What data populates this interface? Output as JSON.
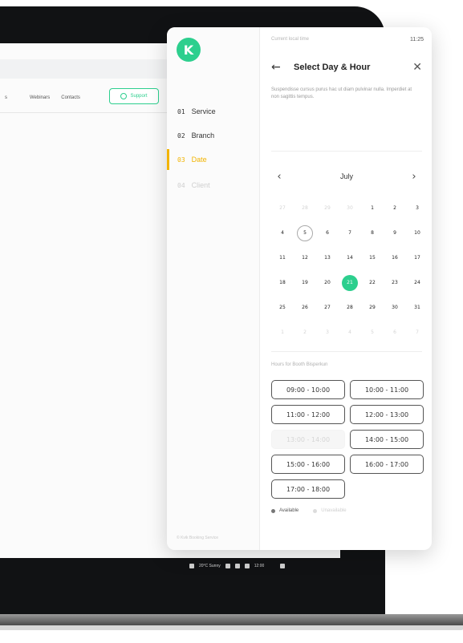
{
  "website": {
    "nav_items": [
      "s",
      "Webinars",
      "Contacts"
    ],
    "support_label": "Support"
  },
  "taskbar": {
    "weather": "20°C Sunny",
    "clock": "12:00"
  },
  "panel": {
    "steps": [
      {
        "num": "01",
        "label": "Service",
        "state": "done"
      },
      {
        "num": "02",
        "label": "Branch",
        "state": "done"
      },
      {
        "num": "03",
        "label": "Date",
        "state": "active"
      },
      {
        "num": "04",
        "label": "Client",
        "state": "disabled"
      }
    ],
    "footer_note": "© Kvik Booking Service"
  },
  "status_bar": {
    "left": "Current local time",
    "time": "11:25"
  },
  "header": {
    "back_icon": "←",
    "title": "Select Day & Hour",
    "close_icon": "✕"
  },
  "description": "Suspendisse cursus purus hac ut diam pulvinar nulla. Imperdiet at non sagittis tempus.",
  "calendar": {
    "prev_icon": "‹",
    "next_icon": "›",
    "month": "July",
    "weeks": [
      [
        {
          "d": "27",
          "s": "muted"
        },
        {
          "d": "28",
          "s": "muted"
        },
        {
          "d": "29",
          "s": "muted"
        },
        {
          "d": "30",
          "s": "muted"
        },
        {
          "d": "1",
          "s": ""
        },
        {
          "d": "2",
          "s": ""
        },
        {
          "d": "3",
          "s": ""
        }
      ],
      [
        {
          "d": "4",
          "s": ""
        },
        {
          "d": "5",
          "s": "today"
        },
        {
          "d": "6",
          "s": ""
        },
        {
          "d": "7",
          "s": ""
        },
        {
          "d": "8",
          "s": ""
        },
        {
          "d": "9",
          "s": ""
        },
        {
          "d": "10",
          "s": ""
        }
      ],
      [
        {
          "d": "11",
          "s": ""
        },
        {
          "d": "12",
          "s": ""
        },
        {
          "d": "13",
          "s": ""
        },
        {
          "d": "14",
          "s": ""
        },
        {
          "d": "15",
          "s": ""
        },
        {
          "d": "16",
          "s": ""
        },
        {
          "d": "17",
          "s": ""
        }
      ],
      [
        {
          "d": "18",
          "s": ""
        },
        {
          "d": "19",
          "s": ""
        },
        {
          "d": "20",
          "s": ""
        },
        {
          "d": "21",
          "s": "selected"
        },
        {
          "d": "22",
          "s": ""
        },
        {
          "d": "23",
          "s": ""
        },
        {
          "d": "24",
          "s": ""
        }
      ],
      [
        {
          "d": "25",
          "s": ""
        },
        {
          "d": "26",
          "s": ""
        },
        {
          "d": "27",
          "s": ""
        },
        {
          "d": "28",
          "s": ""
        },
        {
          "d": "29",
          "s": ""
        },
        {
          "d": "30",
          "s": ""
        },
        {
          "d": "31",
          "s": ""
        }
      ],
      [
        {
          "d": "1",
          "s": "muted"
        },
        {
          "d": "2",
          "s": "muted"
        },
        {
          "d": "3",
          "s": "muted"
        },
        {
          "d": "4",
          "s": "muted"
        },
        {
          "d": "5",
          "s": "muted"
        },
        {
          "d": "6",
          "s": "muted"
        },
        {
          "d": "7",
          "s": "muted"
        }
      ]
    ]
  },
  "hours": {
    "label": "Hours for Booth Bisperkun",
    "slots": [
      {
        "label": "09:00 - 10:00",
        "available": true
      },
      {
        "label": "10:00 - 11:00",
        "available": true
      },
      {
        "label": "11:00 - 12:00",
        "available": true
      },
      {
        "label": "12:00 - 13:00",
        "available": true
      },
      {
        "label": "13:00 - 14:00",
        "available": false
      },
      {
        "label": "14:00 - 15:00",
        "available": true
      },
      {
        "label": "15:00 - 16:00",
        "available": true
      },
      {
        "label": "16:00 - 17:00",
        "available": true
      },
      {
        "label": "17:00 - 18:00",
        "available": true
      }
    ]
  },
  "legend": {
    "available": "Available",
    "unavailable": "Unavailable"
  },
  "colors": {
    "accent": "#2dcf8e",
    "active_step": "#f2b400"
  }
}
